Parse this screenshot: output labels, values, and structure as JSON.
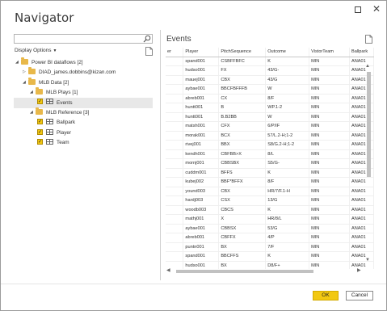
{
  "window": {
    "title": "Navigator"
  },
  "left": {
    "search_placeholder": "",
    "display_options": "Display Options",
    "tree": [
      {
        "label": "Power BI dataflows [2]",
        "kind": "folder",
        "arrow": "◢"
      },
      {
        "label": "DIAD_james.dobbins@kizan.com",
        "kind": "folder",
        "arrow": "▷"
      },
      {
        "label": "MLB Data [2]",
        "kind": "folder",
        "arrow": "◢"
      },
      {
        "label": "MLB Plays [1]",
        "kind": "folder",
        "arrow": "◢"
      },
      {
        "label": "Events",
        "kind": "table",
        "checked": true,
        "selected": true
      },
      {
        "label": "MLB Reference [3]",
        "kind": "folder",
        "arrow": "◢"
      },
      {
        "label": "Ballpark",
        "kind": "table",
        "checked": true
      },
      {
        "label": "Player",
        "kind": "table",
        "checked": true
      },
      {
        "label": "Team",
        "kind": "table",
        "checked": true
      }
    ]
  },
  "right": {
    "preview_title": "Events",
    "columns": [
      "er",
      "Player",
      "PitchSequence",
      "Outcome",
      "VistorTeam",
      "Ballpark"
    ],
    "rows": [
      [
        "",
        "spand001",
        "CSBFFBFC",
        "K",
        "MIN",
        "ANA01"
      ],
      [
        "",
        "hudso001",
        "FX",
        "43/G-",
        "MIN",
        "ANA01"
      ],
      [
        "",
        "mauej001",
        "CBX",
        "43/G",
        "MIN",
        "ANA01"
      ],
      [
        "",
        "aybae001",
        "BBCFBFFFB",
        "W",
        "MIN",
        "ANA01"
      ],
      [
        "",
        "abreb001",
        "CX",
        "8/F",
        "MIN",
        "ANA01"
      ],
      [
        "",
        "huntt001",
        "B",
        "WP.1-2",
        "MIN",
        "ANA01"
      ],
      [
        "",
        "huntt001",
        "B.B2BB",
        "W",
        "MIN",
        "ANA01"
      ],
      [
        "",
        "matsh001",
        "CFX",
        "6/P/IF",
        "MIN",
        "ANA01"
      ],
      [
        "",
        "morak001",
        "BCX",
        "57/L.2-H;1-2",
        "MIN",
        "ANA01"
      ],
      [
        "",
        "rivej001",
        "BBX",
        "S8/G.2-H;1-2",
        "MIN",
        "ANA01"
      ],
      [
        "",
        "kendh001",
        "CBFBB>X",
        "8/L",
        "MIN",
        "ANA01"
      ],
      [
        "",
        "mornj001",
        "CBBSBX",
        "S5/G-",
        "MIN",
        "ANA01"
      ],
      [
        "",
        "cuddm001",
        "BFFS",
        "K",
        "MIN",
        "ANA01"
      ],
      [
        "",
        "kubej002",
        "BBF*BFFX",
        "8/F",
        "MIN",
        "ANA01"
      ],
      [
        "",
        "yound003",
        "CBX",
        "HR/7/F.1-H",
        "MIN",
        "ANA01"
      ],
      [
        "",
        "hardj003",
        "CSX",
        "13/G",
        "MIN",
        "ANA01"
      ],
      [
        "",
        "woodb003",
        "CBCS",
        "K",
        "MIN",
        "ANA01"
      ],
      [
        "",
        "mathj001",
        "X",
        "HR/8/L",
        "MIN",
        "ANA01"
      ],
      [
        "",
        "aybae001",
        "CBBSX",
        "53/G",
        "MIN",
        "ANA01"
      ],
      [
        "",
        "abreb001",
        "CBFFX",
        "4/P",
        "MIN",
        "ANA01"
      ],
      [
        "",
        "puntn001",
        "BX",
        "7/F",
        "MIN",
        "ANA01"
      ],
      [
        "",
        "spand001",
        "BBCFFS",
        "K",
        "MIN",
        "ANA01"
      ],
      [
        "",
        "hudso001",
        "BX",
        "D8/F+",
        "MIN",
        "ANA01"
      ]
    ]
  },
  "footer": {
    "ok_label": "OK",
    "cancel_label": "Cancel"
  },
  "colors": {
    "accent": "#f2c811",
    "folder": "#e8b84a"
  }
}
